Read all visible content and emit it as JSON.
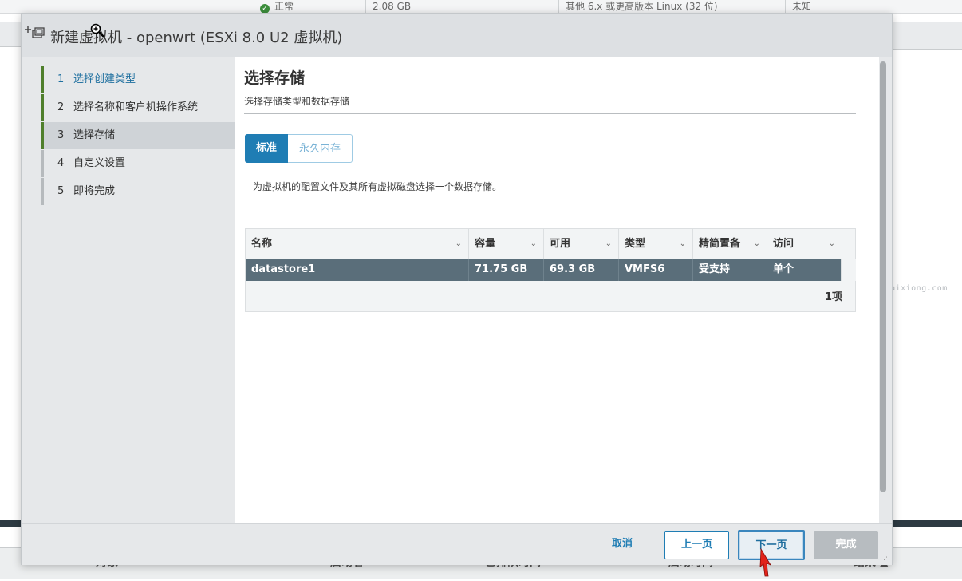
{
  "background": {
    "top_row": {
      "status": "正常",
      "memory": "2.08 GB",
      "guest_os": "其他 6.x 或更高版本 Linux (32 位)",
      "host_name": "未知"
    },
    "bottom_headers": [
      "对象",
      "启动者",
      "已排队时间",
      "启动时间",
      "结果 ▲"
    ],
    "watermark": "Yangaixiong.com"
  },
  "dialog": {
    "title": "新建虚拟机 - openwrt (ESXi 8.0 U2 虚拟机)",
    "steps": [
      {
        "num": "1",
        "label": "选择创建类型",
        "state": "done"
      },
      {
        "num": "2",
        "label": "选择名称和客户机操作系统",
        "state": "complete"
      },
      {
        "num": "3",
        "label": "选择存储",
        "state": "active"
      },
      {
        "num": "4",
        "label": "自定义设置",
        "state": "pending"
      },
      {
        "num": "5",
        "label": "即将完成",
        "state": "pending"
      }
    ],
    "page_title": "选择存储",
    "page_subtitle": "选择存储类型和数据存储",
    "storage_types": {
      "standard": "标准",
      "persistent_memory": "永久内存"
    },
    "description": "为虚拟机的配置文件及其所有虚拟磁盘选择一个数据存储。",
    "table": {
      "columns": [
        "名称",
        "容量",
        "可用",
        "类型",
        "精简置备",
        "访问"
      ],
      "rows": [
        {
          "name": "datastore1",
          "capacity": "71.75 GB",
          "free": "69.3 GB",
          "type": "VMFS6",
          "thin": "受支持",
          "access": "单个"
        }
      ],
      "footer": "1项"
    },
    "buttons": {
      "cancel": "取消",
      "back": "上一页",
      "next": "下一页",
      "finish": "完成"
    }
  },
  "colors": {
    "accent": "#1f7db4",
    "step_done": "#4f7f2c",
    "selected_row": "#5a6e7a"
  },
  "icons": [
    "new-vm-icon",
    "zoom-cursor-icon",
    "chevron-down-icon",
    "arrow-cursor-icon"
  ]
}
